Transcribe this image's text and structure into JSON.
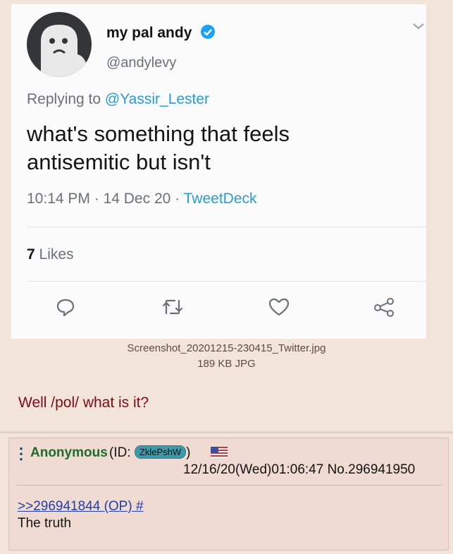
{
  "tweet": {
    "display_name": "my pal andy",
    "handle": "@andylevy",
    "replying_prefix": "Replying to",
    "replying_to": "@Yassir_Lester",
    "text_line1": "what's something that feels",
    "text_line2": "antisemitic but isn't",
    "time": "10:14 PM",
    "date": "14 Dec 20",
    "source": "TweetDeck",
    "likes_count": "7",
    "likes_label": "Likes",
    "icons": [
      "reply-icon",
      "retweet-icon",
      "like-icon",
      "share-icon"
    ]
  },
  "op": {
    "filename": "Screenshot_20201215-230415_Twitter.jpg",
    "filesize": "189 KB JPG",
    "comment": "Well /pol/ what is it?"
  },
  "reply": {
    "name": "Anonymous",
    "id_prefix": "(ID:",
    "id": "ZklePshW",
    "id_suffix": ")",
    "datetime": "12/16/20(Wed)01:06:47 No.296941950",
    "quotelink": ">>296941844 (OP) #",
    "text": "The truth"
  },
  "colors": {
    "verified": "#1da1f2",
    "link": "#2a9bd3",
    "anon_name": "#1f6d2c",
    "op_text": "#7d0b14",
    "quote_link": "#203fa8"
  }
}
